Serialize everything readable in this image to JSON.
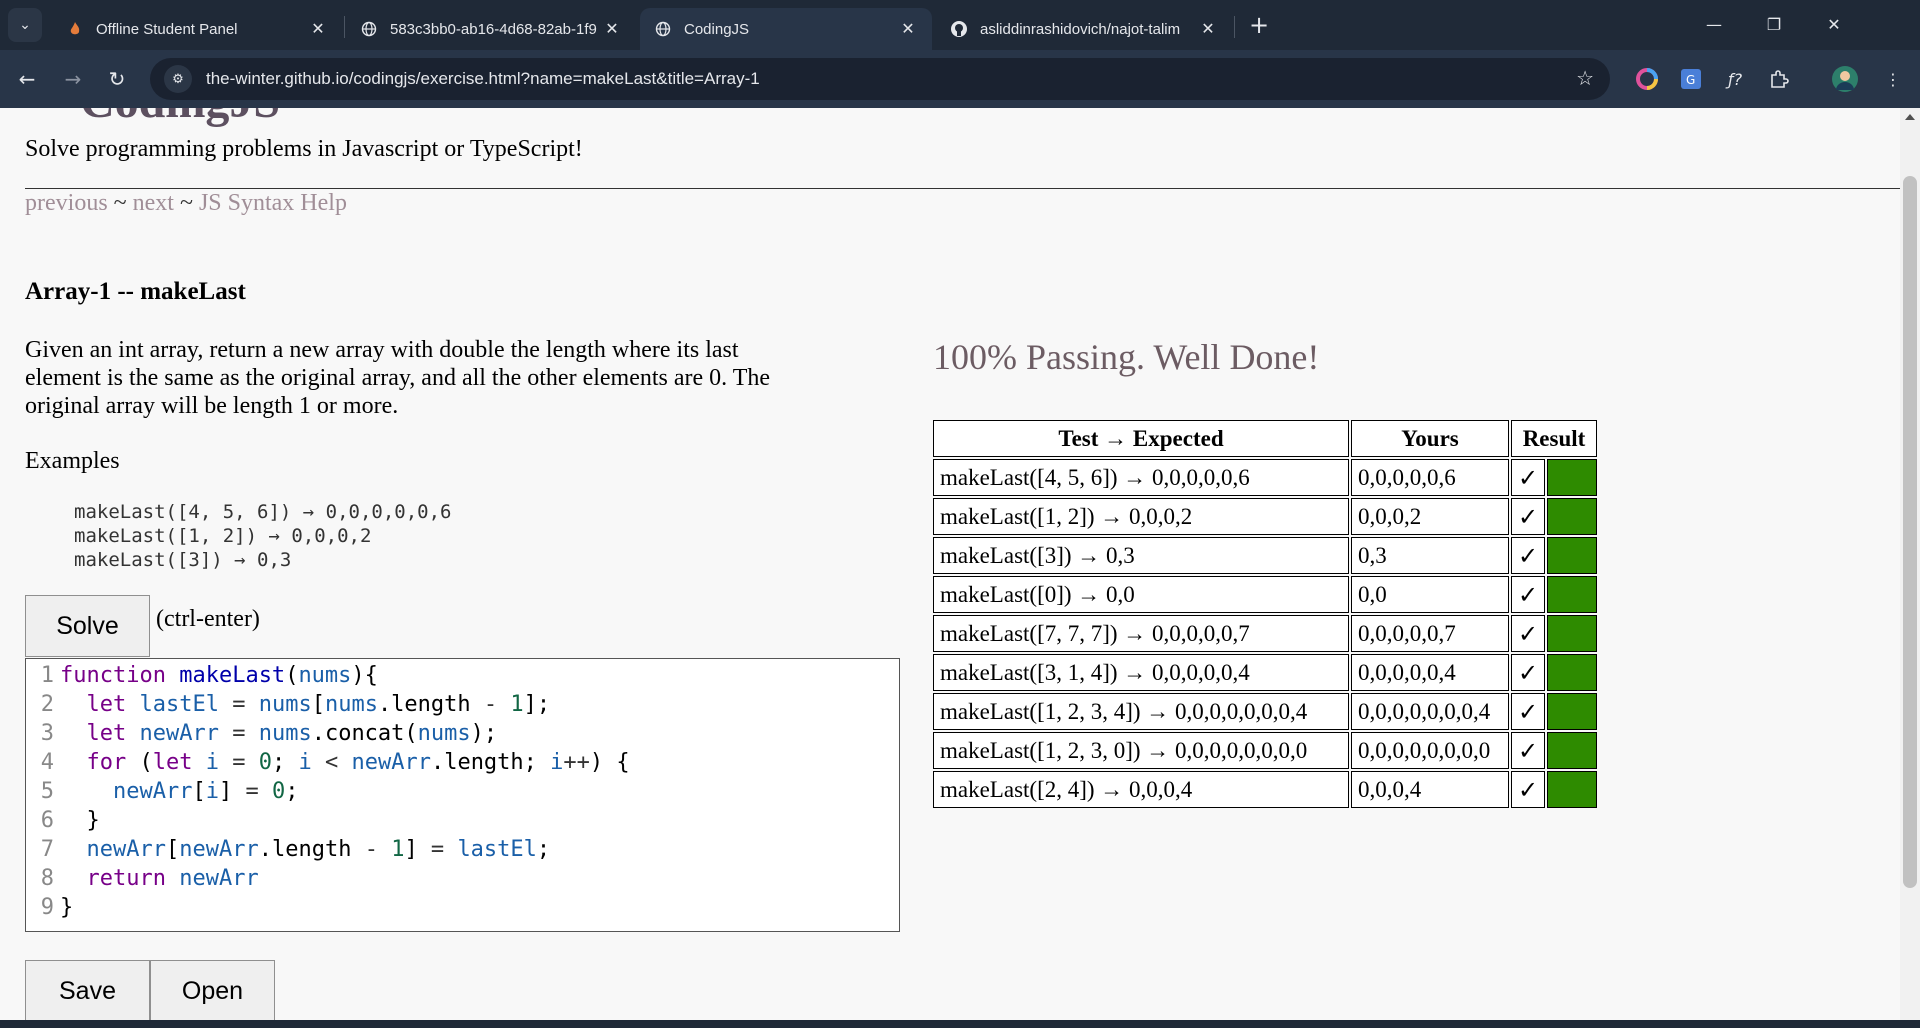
{
  "browser": {
    "tabs": [
      {
        "title": "Offline Student Panel",
        "icon": "flame-icon"
      },
      {
        "title": "583c3bb0-ab16-4d68-82ab-1f9",
        "icon": "globe-icon"
      },
      {
        "title": "CodingJS",
        "icon": "globe-icon",
        "active": true
      },
      {
        "title": "asliddinrashidovich/najot-talim",
        "icon": "github-icon"
      }
    ],
    "url": "the-winter.github.io/codingjs/exercise.html?name=makeLast&title=Array-1"
  },
  "page": {
    "tagline": "Solve programming problems in Javascript or TypeScript!",
    "nav": {
      "previous": "previous",
      "sep1": " ~ ",
      "next": "next",
      "sep2": " ~ ",
      "help": "JS Syntax Help"
    },
    "problem_title": "Array-1 -- makeLast",
    "description": "Given an int array, return a new array with double the length where its last element is the same as the original array, and all the other elements are 0. The original array will be length 1 or more.",
    "examples_heading": "Examples",
    "examples": [
      "makeLast([4, 5, 6]) → 0,0,0,0,0,6",
      "makeLast([1, 2]) → 0,0,0,2",
      "makeLast([3]) → 0,3"
    ],
    "solve_label": "Solve",
    "solve_hint": "(ctrl-enter)",
    "save_label": "Save",
    "open_label": "Open",
    "pass_message": "100% Passing. Well Done!",
    "results": {
      "headers": [
        "Test → Expected",
        "Yours",
        "Result"
      ],
      "rows": [
        {
          "test": "makeLast([4, 5, 6]) → 0,0,0,0,0,6",
          "yours": "0,0,0,0,0,6",
          "mark": "✓"
        },
        {
          "test": "makeLast([1, 2]) → 0,0,0,2",
          "yours": "0,0,0,2",
          "mark": "✓"
        },
        {
          "test": "makeLast([3]) → 0,3",
          "yours": "0,3",
          "mark": "✓"
        },
        {
          "test": "makeLast([0]) → 0,0",
          "yours": "0,0",
          "mark": "✓"
        },
        {
          "test": "makeLast([7, 7, 7]) → 0,0,0,0,0,7",
          "yours": "0,0,0,0,0,7",
          "mark": "✓"
        },
        {
          "test": "makeLast([3, 1, 4]) → 0,0,0,0,0,4",
          "yours": "0,0,0,0,0,4",
          "mark": "✓"
        },
        {
          "test": "makeLast([1, 2, 3, 4]) → 0,0,0,0,0,0,0,4",
          "yours": "0,0,0,0,0,0,0,4",
          "mark": "✓"
        },
        {
          "test": "makeLast([1, 2, 3, 0]) → 0,0,0,0,0,0,0,0",
          "yours": "0,0,0,0,0,0,0,0",
          "mark": "✓"
        },
        {
          "test": "makeLast([2, 4]) → 0,0,0,4",
          "yours": "0,0,0,4",
          "mark": "✓"
        }
      ]
    }
  },
  "code_lines": [
    [
      [
        "kw",
        "function "
      ],
      [
        "fn",
        "makeLast"
      ],
      [
        "tx",
        "("
      ],
      [
        "vr",
        "nums"
      ],
      [
        "tx",
        "){"
      ]
    ],
    [
      [
        "tx",
        "  "
      ],
      [
        "kw",
        "let "
      ],
      [
        "vr",
        "lastEl"
      ],
      [
        "op",
        " = "
      ],
      [
        "vr",
        "nums"
      ],
      [
        "tx",
        "["
      ],
      [
        "vr",
        "nums"
      ],
      [
        "tx",
        ".length "
      ],
      [
        "op",
        "- "
      ],
      [
        "nm",
        "1"
      ],
      [
        "tx",
        "];"
      ]
    ],
    [
      [
        "tx",
        "  "
      ],
      [
        "kw",
        "let "
      ],
      [
        "vr",
        "newArr"
      ],
      [
        "op",
        " = "
      ],
      [
        "vr",
        "nums"
      ],
      [
        "tx",
        ".concat("
      ],
      [
        "vr",
        "nums"
      ],
      [
        "tx",
        ");"
      ]
    ],
    [
      [
        "tx",
        "  "
      ],
      [
        "kw",
        "for "
      ],
      [
        "tx",
        "("
      ],
      [
        "kw",
        "let "
      ],
      [
        "vr",
        "i"
      ],
      [
        "op",
        " = "
      ],
      [
        "nm",
        "0"
      ],
      [
        "tx",
        "; "
      ],
      [
        "vr",
        "i"
      ],
      [
        "op",
        " < "
      ],
      [
        "vr",
        "newArr"
      ],
      [
        "tx",
        ".length; "
      ],
      [
        "vr",
        "i"
      ],
      [
        "op",
        "++"
      ],
      [
        "tx",
        ") {"
      ]
    ],
    [
      [
        "tx",
        "    "
      ],
      [
        "vr",
        "newArr"
      ],
      [
        "tx",
        "["
      ],
      [
        "vr",
        "i"
      ],
      [
        "tx",
        "]"
      ],
      [
        "op",
        " = "
      ],
      [
        "nm",
        "0"
      ],
      [
        "tx",
        ";"
      ]
    ],
    [
      [
        "tx",
        "  }"
      ]
    ],
    [
      [
        "tx",
        "  "
      ],
      [
        "vr",
        "newArr"
      ],
      [
        "tx",
        "["
      ],
      [
        "vr",
        "newArr"
      ],
      [
        "tx",
        ".length "
      ],
      [
        "op",
        "- "
      ],
      [
        "nm",
        "1"
      ],
      [
        "tx",
        "]"
      ],
      [
        "op",
        " = "
      ],
      [
        "vr",
        "lastEl"
      ],
      [
        "tx",
        ";"
      ]
    ],
    [
      [
        "tx",
        "  "
      ],
      [
        "kw",
        "return "
      ],
      [
        "vr",
        "newArr"
      ]
    ],
    [
      [
        "tx",
        "}"
      ]
    ]
  ],
  "colors": {
    "pass": "#2e8b00",
    "link": "#a08e97",
    "heading_accent": "#6c5c63"
  }
}
